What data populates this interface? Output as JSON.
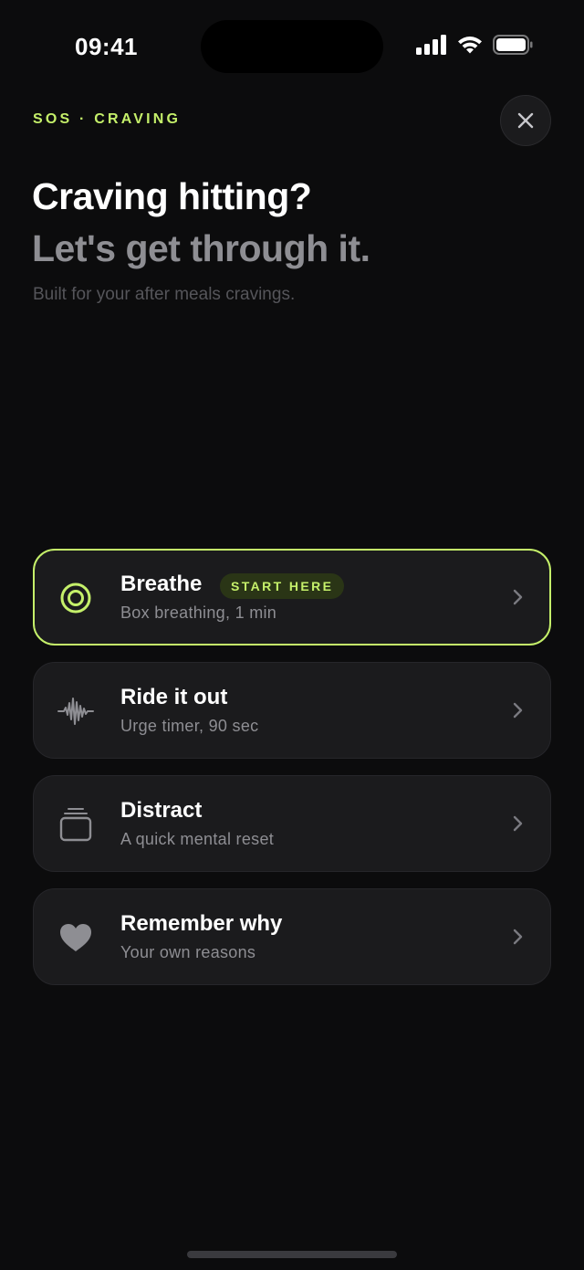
{
  "status_bar": {
    "time": "09:41",
    "icons": [
      "cellular-signal-icon",
      "wifi-icon",
      "battery-icon"
    ]
  },
  "header": {
    "eyebrow": "SOS · CRAVING",
    "close_icon": "close-icon",
    "title": "Craving hitting?",
    "subtitle": "Let's get through it.",
    "context": "Built for your after meals cravings."
  },
  "options": [
    {
      "title": "Breathe",
      "subtitle": "Box breathing, 1 min",
      "badge": "START HERE",
      "icon": "breathe-target-icon",
      "highlighted": true
    },
    {
      "title": "Ride it out",
      "subtitle": "Urge timer, 90 sec",
      "icon": "waveform-icon",
      "highlighted": false
    },
    {
      "title": "Distract",
      "subtitle": "A quick mental reset",
      "icon": "card-stack-icon",
      "highlighted": false
    },
    {
      "title": "Remember why",
      "subtitle": "Your own reasons",
      "icon": "heart-icon",
      "highlighted": false
    }
  ],
  "colors": {
    "background": "#0c0c0d",
    "accent": "#c5f06a",
    "card": "#1b1b1d",
    "muted_text": "#8e8e93"
  }
}
